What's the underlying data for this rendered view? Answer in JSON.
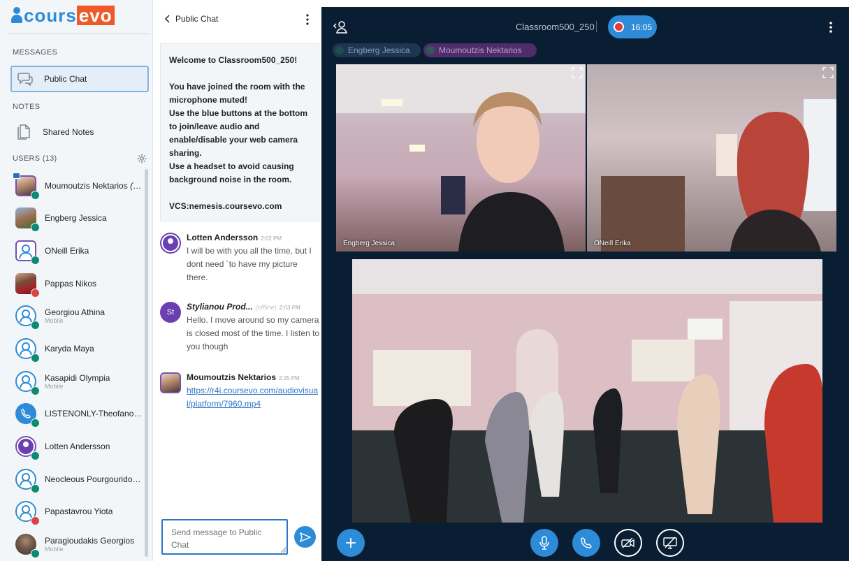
{
  "sidebar": {
    "logo_a": "cours",
    "logo_b": "evo",
    "messages_title": "MESSAGES",
    "public_chat": "Public Chat",
    "notes_title": "NOTES",
    "shared_notes": "Shared Notes",
    "users_title": "USERS (13)",
    "users": [
      {
        "name": "Moumoutzis Nektarios",
        "suffix": "(You)",
        "sub": "",
        "status": "talk"
      },
      {
        "name": "Engberg Jessica",
        "sub": "",
        "status": "talk"
      },
      {
        "name": "ONeill Erika",
        "sub": "",
        "status": "talk"
      },
      {
        "name": "Pappas Nikos",
        "sub": "",
        "status": "muted"
      },
      {
        "name": "Georgiou Athina",
        "sub": "Mobile",
        "status": "listen"
      },
      {
        "name": "Karyda Maya",
        "sub": "",
        "status": "listen"
      },
      {
        "name": "Kasapidi Olympia",
        "sub": "Mobile",
        "status": "listen"
      },
      {
        "name": "LISTENONLY-Theofanous...",
        "sub": "",
        "status": "listen"
      },
      {
        "name": "Lotten Andersson",
        "sub": "",
        "status": "listen"
      },
      {
        "name": "Neocleous Pourgouridou ...",
        "sub": "",
        "status": "listen"
      },
      {
        "name": "Papastavrou Yiota",
        "sub": "",
        "status": "muted"
      },
      {
        "name": "Paragioudakis Georgios",
        "sub": "Mobile",
        "status": "listen"
      }
    ]
  },
  "chat": {
    "header": "Public Chat",
    "welcome": [
      "Welcome to Classroom500_250!",
      "",
      "You have joined the room with the microphone muted!",
      "Use the blue buttons at the bottom to join/leave audio and enable/disable your web camera sharing.",
      "Use a headset to avoid causing background noise in the room.",
      "",
      "VCS:nemesis.coursevo.com"
    ],
    "messages": [
      {
        "initials": "",
        "name": "Lotten Andersson",
        "offline": "",
        "time": "2:02 PM",
        "text": "I will be with you all the time, but I dont need ´to have my picture there.",
        "link": ""
      },
      {
        "initials": "St",
        "name": "Stylianou Prod...",
        "offline": "(offline)",
        "time": "2:03 PM",
        "text": "Hello. I move around so my camera is closed most of the time. I listen to you though",
        "link": ""
      },
      {
        "initials": "",
        "name": "Moumoutzis Nektarios",
        "offline": "",
        "time": "2:25 PM",
        "text": "",
        "link": "https://r4i.coursevo.com/audiovisual/platform/7960.mp4"
      }
    ],
    "input_placeholder": "Send message to Public Chat"
  },
  "main": {
    "room_title": "Classroom500_250",
    "rec_time": "16:05",
    "talkers": [
      "Engberg Jessica",
      "Moumoutzis Nektarios"
    ],
    "tiles": [
      "Engberg Jessica",
      "ONeill Erika"
    ],
    "colors": {
      "bg": "#0a1e33",
      "accent": "#2d8bd7"
    }
  }
}
